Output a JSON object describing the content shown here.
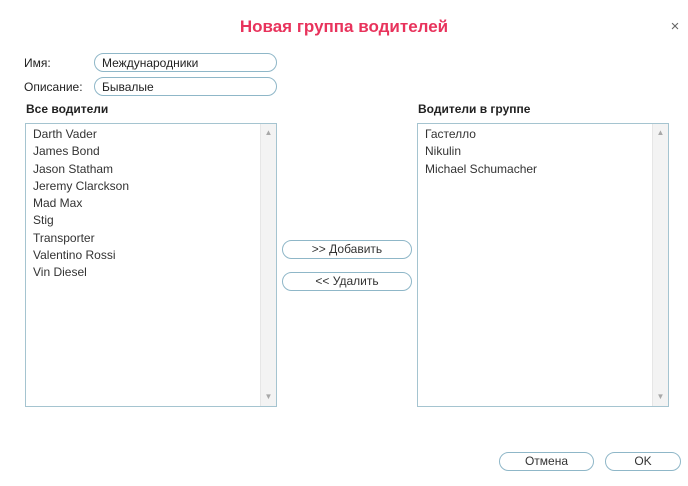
{
  "dialog": {
    "title": "Новая группа водителей",
    "close_glyph": "×"
  },
  "form": {
    "name_label": "Имя:",
    "name_value": "Международники",
    "description_label": "Описание:",
    "description_value": "Бывалые"
  },
  "all_drivers": {
    "title": "Все водители",
    "items": [
      "Darth Vader",
      "James Bond",
      "Jason Statham",
      "Jeremy Clarckson",
      "Mad Max",
      "Stig",
      "Transporter",
      "Valentino Rossi",
      "Vin Diesel"
    ]
  },
  "group_drivers": {
    "title": "Водители в группе",
    "items": [
      "Гастелло",
      "Nikulin",
      "Michael Schumacher"
    ]
  },
  "actions": {
    "add_label": ">> Добавить",
    "remove_label": "<< Удалить"
  },
  "footer": {
    "cancel_label": "Отмена",
    "ok_label": "OK"
  },
  "icons": {
    "scroll_up": "▲",
    "scroll_down": "▼"
  },
  "colors": {
    "title": "#e8335c",
    "border": "#8fb7c8"
  }
}
